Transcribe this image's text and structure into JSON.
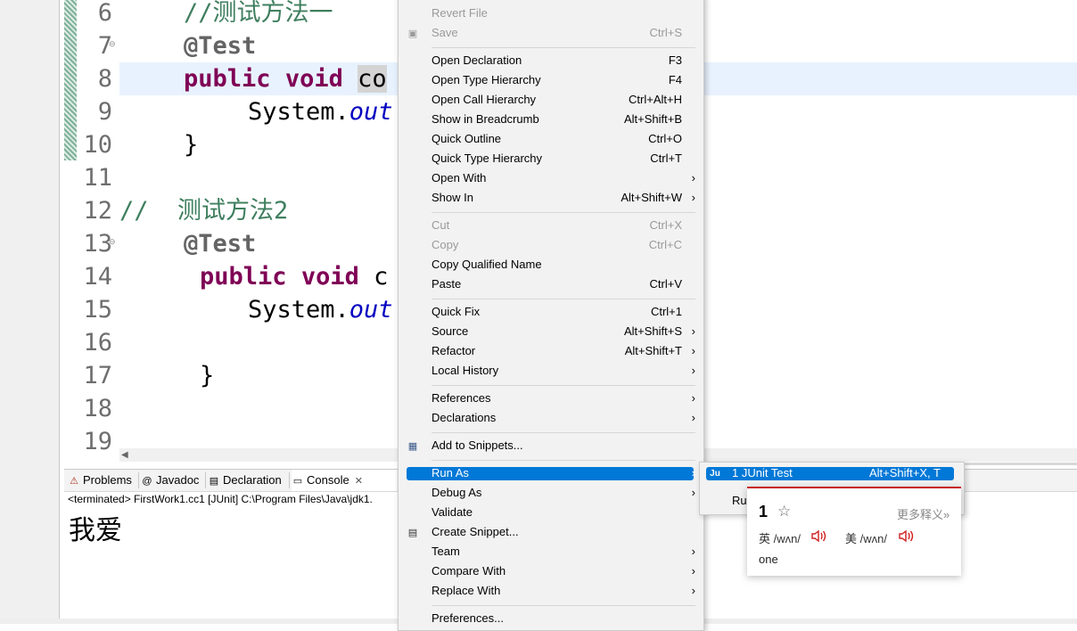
{
  "editor": {
    "line_numbers": [
      "6",
      "7",
      "8",
      "9",
      "10",
      "11",
      "12",
      "13",
      "14",
      "15",
      "16",
      "17",
      "18",
      "19"
    ],
    "lines": {
      "l6_comment": "//测试方法一",
      "l7_annotation": "@Test",
      "l8_kw_public": "public",
      "l8_kw_void": "void",
      "l8_name": "co",
      "l9_sys": "System.",
      "l9_field": "out",
      "l10_brace": "}",
      "l12_comment": "//  测试方法2",
      "l13_annotation": "@Test",
      "l14_kw_public": "public",
      "l14_kw_void": "void",
      "l14_name": "c",
      "l15_sys": "System.",
      "l15_field": "out",
      "l17_brace": "}"
    }
  },
  "bottom_panel": {
    "tabs": [
      "Problems",
      "Javadoc",
      "Declaration",
      "Console"
    ],
    "terminated_text": "<terminated> FirstWork1.cc1 [JUnit] C:\\Program Files\\Java\\jdk1.",
    "console_output": "我爱"
  },
  "context_menu": {
    "top_items": [
      {
        "label": "Revert File",
        "shortcut": "",
        "disabled": true
      },
      {
        "label": "Save",
        "shortcut": "Ctrl+S",
        "disabled": true
      }
    ],
    "group1": [
      {
        "label": "Open Declaration",
        "shortcut": "F3"
      },
      {
        "label": "Open Type Hierarchy",
        "shortcut": "F4"
      },
      {
        "label": "Open Call Hierarchy",
        "shortcut": "Ctrl+Alt+H"
      },
      {
        "label": "Show in Breadcrumb",
        "shortcut": "Alt+Shift+B"
      },
      {
        "label": "Quick Outline",
        "shortcut": "Ctrl+O"
      },
      {
        "label": "Quick Type Hierarchy",
        "shortcut": "Ctrl+T"
      },
      {
        "label": "Open With",
        "shortcut": ""
      },
      {
        "label": "Show In",
        "shortcut": "Alt+Shift+W"
      }
    ],
    "group2": [
      {
        "label": "Cut",
        "shortcut": "Ctrl+X"
      },
      {
        "label": "Copy",
        "shortcut": "Ctrl+C"
      },
      {
        "label": "Copy Qualified Name",
        "shortcut": ""
      },
      {
        "label": "Paste",
        "shortcut": "Ctrl+V"
      }
    ],
    "group3": [
      {
        "label": "Quick Fix",
        "shortcut": "Ctrl+1"
      },
      {
        "label": "Source",
        "shortcut": "Alt+Shift+S"
      },
      {
        "label": "Refactor",
        "shortcut": "Alt+Shift+T"
      },
      {
        "label": "Local History",
        "shortcut": ""
      }
    ],
    "group4": [
      {
        "label": "References",
        "shortcut": ""
      },
      {
        "label": "Declarations",
        "shortcut": ""
      }
    ],
    "group5": [
      {
        "label": "Add to Snippets...",
        "shortcut": ""
      }
    ],
    "group6": [
      {
        "label": "Run As",
        "shortcut": ""
      },
      {
        "label": "Debug As",
        "shortcut": ""
      },
      {
        "label": "Validate",
        "shortcut": ""
      },
      {
        "label": "Create Snippet...",
        "shortcut": ""
      },
      {
        "label": "Team",
        "shortcut": ""
      },
      {
        "label": "Compare With",
        "shortcut": ""
      },
      {
        "label": "Replace With",
        "shortcut": ""
      }
    ],
    "bottom_item": "Preferences...",
    "arrow": "›"
  },
  "run_as_submenu": {
    "item_label": "1 JUnit Test",
    "item_shortcut": "Alt+Shift+X, T",
    "partial_item": "Ru"
  },
  "dictionary_popup": {
    "word": "1",
    "star": "☆",
    "more_link": "更多释义»",
    "uk_label": "英",
    "uk_phonetic": "/wʌn/",
    "us_label": "美",
    "us_phonetic": "/wʌn/",
    "meaning": "one"
  },
  "colors": {
    "menu_highlight": "#0078d7",
    "comment": "#3f7f5f",
    "keyword": "#7f0055",
    "field": "#0000c0"
  }
}
